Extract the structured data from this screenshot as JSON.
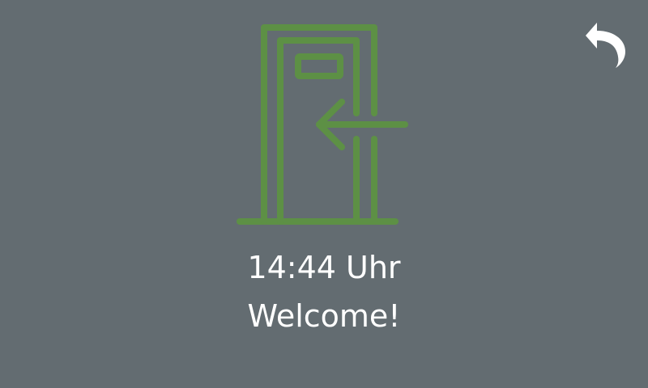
{
  "screen": {
    "background_color": "#636c71",
    "accent_color": "#5d9045",
    "text_color": "#ffffff"
  },
  "status": {
    "time": "14:44 Uhr",
    "message": "Welcome!"
  },
  "icons": {
    "main": "door-enter-icon",
    "back": "back-arrow-icon"
  }
}
